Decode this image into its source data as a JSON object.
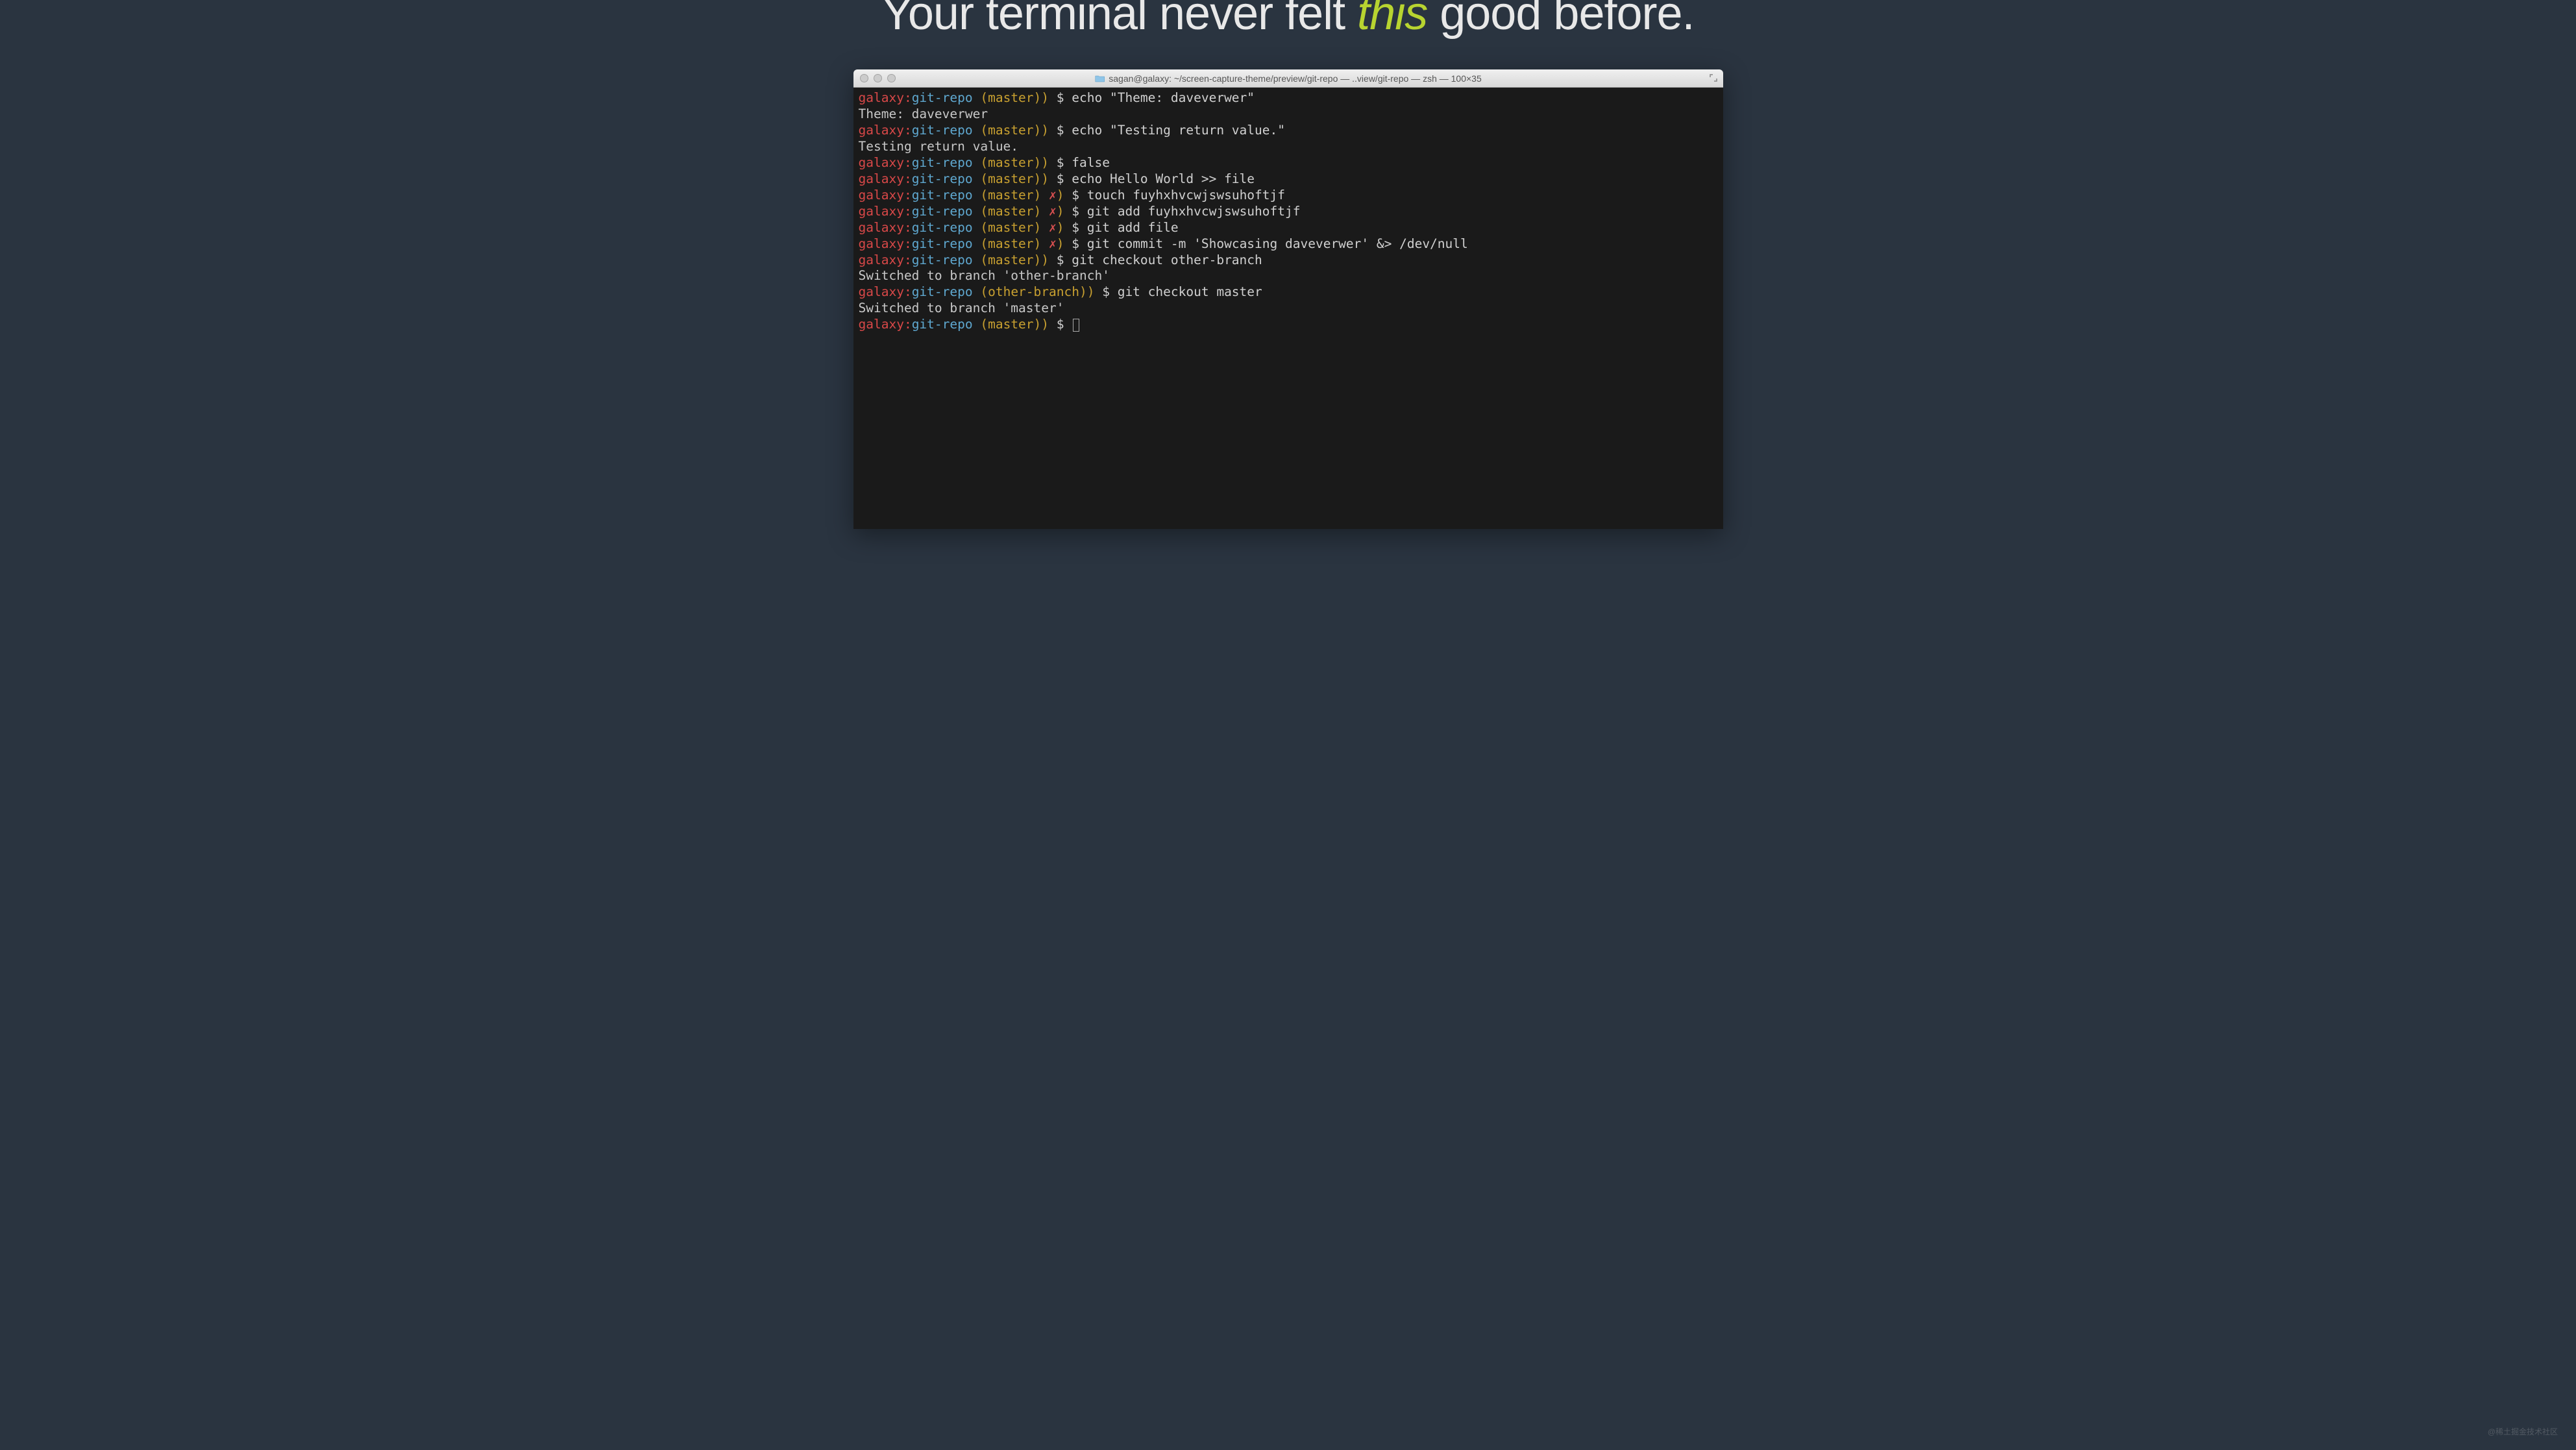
{
  "headline": {
    "before": "Your terminal never felt ",
    "emphasis": "this",
    "after": " good before."
  },
  "window": {
    "title": "sagan@galaxy: ~/screen-capture-theme/preview/git-repo — ..view/git-repo — zsh — 100×35"
  },
  "prompt": {
    "host": "galaxy",
    "path": "git-repo",
    "branch_master": "master",
    "branch_other": "other-branch",
    "dirty_marker": "✗",
    "symbol": "$"
  },
  "lines": [
    {
      "type": "prompt",
      "branch": "master",
      "dirty": false,
      "cmd": "echo \"Theme: daveverwer\""
    },
    {
      "type": "output",
      "text": "Theme: daveverwer"
    },
    {
      "type": "prompt",
      "branch": "master",
      "dirty": false,
      "cmd": "echo \"Testing return value.\""
    },
    {
      "type": "output",
      "text": "Testing return value."
    },
    {
      "type": "prompt",
      "branch": "master",
      "dirty": false,
      "cmd": "false"
    },
    {
      "type": "prompt",
      "branch": "master",
      "dirty": false,
      "cmd": "echo Hello World >> file"
    },
    {
      "type": "prompt",
      "branch": "master",
      "dirty": true,
      "cmd": "touch fuyhxhvcwjswsuhoftjf"
    },
    {
      "type": "prompt",
      "branch": "master",
      "dirty": true,
      "cmd": "git add fuyhxhvcwjswsuhoftjf"
    },
    {
      "type": "prompt",
      "branch": "master",
      "dirty": true,
      "cmd": "git add file"
    },
    {
      "type": "prompt",
      "branch": "master",
      "dirty": true,
      "cmd": "git commit -m 'Showcasing daveverwer' &> /dev/null"
    },
    {
      "type": "prompt",
      "branch": "master",
      "dirty": false,
      "cmd": "git checkout other-branch"
    },
    {
      "type": "output",
      "text": "Switched to branch 'other-branch'"
    },
    {
      "type": "prompt",
      "branch": "other-branch",
      "dirty": false,
      "cmd": "git checkout master"
    },
    {
      "type": "output",
      "text": "Switched to branch 'master'"
    },
    {
      "type": "prompt",
      "branch": "master",
      "dirty": false,
      "cmd": "",
      "cursor": true
    }
  ],
  "watermark": "@稀土掘金技术社区"
}
